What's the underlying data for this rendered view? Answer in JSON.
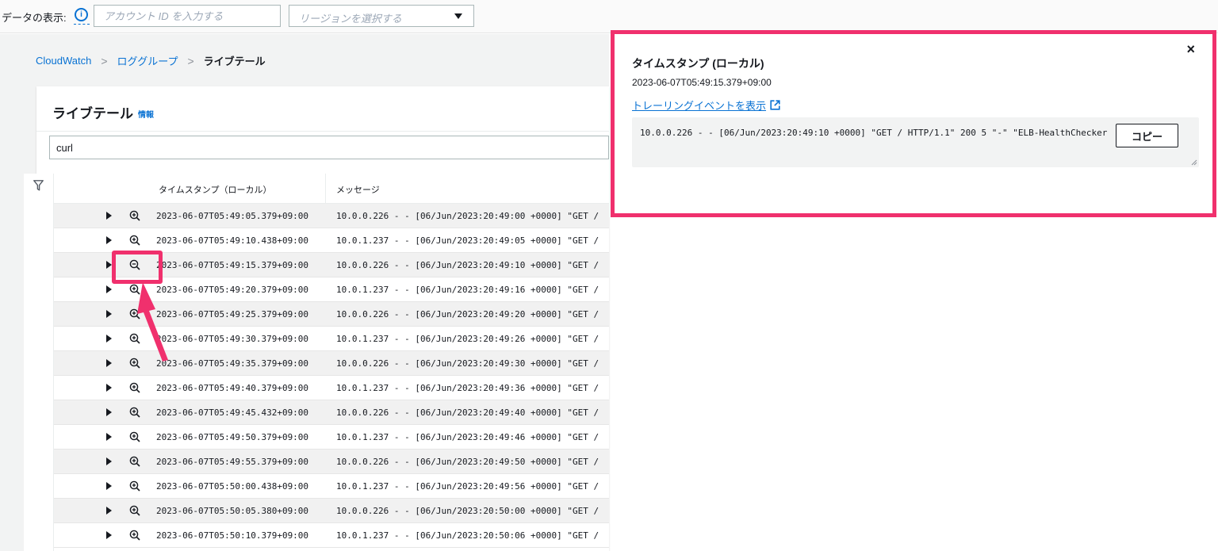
{
  "topbar": {
    "label": "データの表示:",
    "account_placeholder": "アカウント ID を入力する",
    "region_placeholder": "リージョンを選択する"
  },
  "breadcrumb": {
    "items": [
      "CloudWatch",
      "ロググループ",
      "ライブテール"
    ]
  },
  "page": {
    "title": "ライブテール",
    "info_link": "情報",
    "filter_value": "curl"
  },
  "table": {
    "columns": [
      "タイムスタンプ（ローカル）",
      "メッセージ"
    ],
    "rows": [
      {
        "ts": "2023-06-07T05:49:05.379+09:00",
        "msg": "10.0.0.226 - - [06/Jun/2023:20:49:00 +0000] \"GET /"
      },
      {
        "ts": "2023-06-07T05:49:10.438+09:00",
        "msg": "10.0.1.237 - - [06/Jun/2023:20:49:05 +0000] \"GET /"
      },
      {
        "ts": "2023-06-07T05:49:15.379+09:00",
        "msg": "10.0.0.226 - - [06/Jun/2023:20:49:10 +0000] \"GET /"
      },
      {
        "ts": "2023-06-07T05:49:20.379+09:00",
        "msg": "10.0.1.237 - - [06/Jun/2023:20:49:16 +0000] \"GET /"
      },
      {
        "ts": "2023-06-07T05:49:25.379+09:00",
        "msg": "10.0.0.226 - - [06/Jun/2023:20:49:20 +0000] \"GET /"
      },
      {
        "ts": "2023-06-07T05:49:30.379+09:00",
        "msg": "10.0.1.237 - - [06/Jun/2023:20:49:26 +0000] \"GET /"
      },
      {
        "ts": "2023-06-07T05:49:35.379+09:00",
        "msg": "10.0.0.226 - - [06/Jun/2023:20:49:30 +0000] \"GET /"
      },
      {
        "ts": "2023-06-07T05:49:40.379+09:00",
        "msg": "10.0.1.237 - - [06/Jun/2023:20:49:36 +0000] \"GET /"
      },
      {
        "ts": "2023-06-07T05:49:45.432+09:00",
        "msg": "10.0.0.226 - - [06/Jun/2023:20:49:40 +0000] \"GET /"
      },
      {
        "ts": "2023-06-07T05:49:50.379+09:00",
        "msg": "10.0.1.237 - - [06/Jun/2023:20:49:46 +0000] \"GET /"
      },
      {
        "ts": "2023-06-07T05:49:55.379+09:00",
        "msg": "10.0.0.226 - - [06/Jun/2023:20:49:50 +0000] \"GET /"
      },
      {
        "ts": "2023-06-07T05:50:00.438+09:00",
        "msg": "10.0.1.237 - - [06/Jun/2023:20:49:56 +0000] \"GET /"
      },
      {
        "ts": "2023-06-07T05:50:05.380+09:00",
        "msg": "10.0.0.226 - - [06/Jun/2023:20:50:00 +0000] \"GET /"
      },
      {
        "ts": "2023-06-07T05:50:10.379+09:00",
        "msg": "10.0.1.237 - - [06/Jun/2023:20:50:06 +0000] \"GET /"
      }
    ]
  },
  "popup": {
    "title": "タイムスタンプ (ローカル)",
    "value": "2023-06-07T05:49:15.379+09:00",
    "link": "トレーリングイベントを表示",
    "code": "10.0.0.226 - - [06/Jun/2023:20:49:10 +0000] \"GET / HTTP/1.1\" 200 5 \"-\" \"ELB-HealthChecker",
    "copy_label": "コピー",
    "close_glyph": "×"
  },
  "colors": {
    "accent": "#0972d3",
    "highlight": "#f0306d"
  },
  "icons": {
    "info": "info-icon",
    "filter": "filter-icon",
    "zoom_in": "zoom-in-icon",
    "zoom_out": "zoom-out-icon",
    "expand": "caret-right-icon",
    "external": "external-link-icon"
  }
}
